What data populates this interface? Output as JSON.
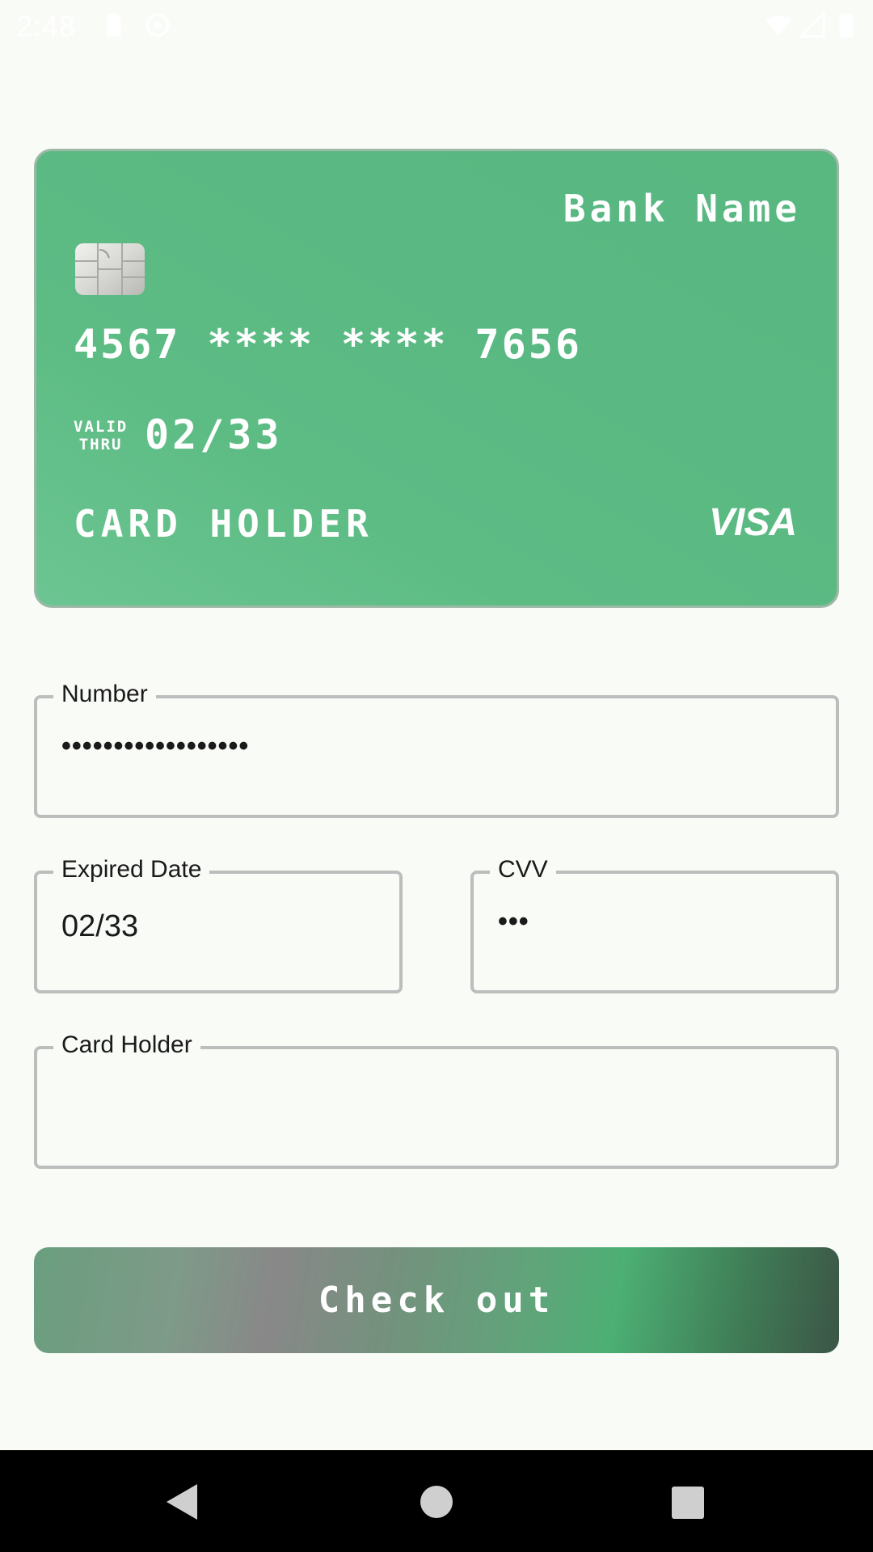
{
  "status_bar": {
    "time": "2:48",
    "icons": [
      "sd-card-icon",
      "sync-icon",
      "wifi-icon",
      "signal-icon",
      "battery-icon"
    ]
  },
  "card": {
    "bank_name": "Bank Name",
    "number": "4567 **** **** 7656",
    "valid_label_1": "VALID",
    "valid_label_2": "THRU",
    "expiry": "02/33",
    "holder": "CARD HOLDER",
    "brand": "VISA",
    "color": "#5ab982"
  },
  "form": {
    "number": {
      "label": "Number",
      "value": "••••••••••••••••••"
    },
    "expiry": {
      "label": "Expired Date",
      "value": "02/33"
    },
    "cvv": {
      "label": "CVV",
      "value": "•••"
    },
    "holder": {
      "label": "Card Holder",
      "value": ""
    }
  },
  "checkout": {
    "label": "Check out"
  },
  "nav": {
    "icons": [
      "back-icon",
      "home-icon",
      "recents-icon"
    ]
  }
}
